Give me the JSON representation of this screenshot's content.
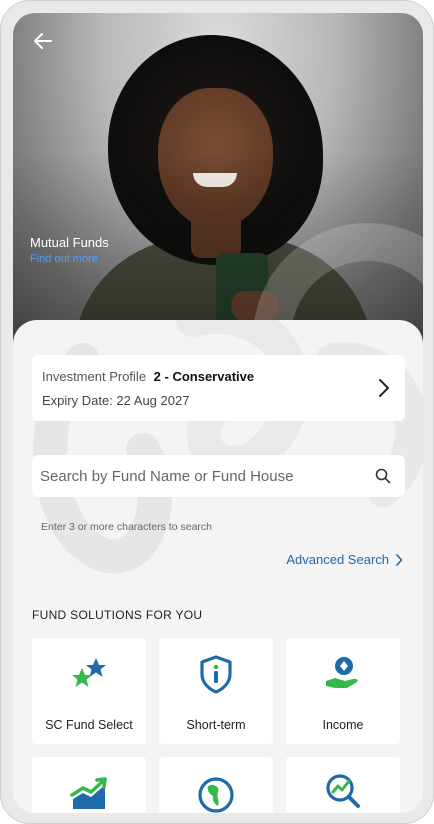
{
  "hero": {
    "title": "Mutual Funds",
    "link": "Find out more"
  },
  "profile": {
    "label": "Investment Profile",
    "value": "2 - Conservative",
    "expiry": "Expiry Date: 22 Aug 2027"
  },
  "search": {
    "placeholder": "Search by Fund Name or Fund House",
    "hint": "Enter 3 or more characters to search",
    "advanced_label": "Advanced Search"
  },
  "solutions": {
    "title": "FUND SOLUTIONS FOR YOU",
    "items": [
      {
        "label": "SC Fund Select",
        "icon": "stars-icon"
      },
      {
        "label": "Short-term",
        "icon": "info-shield-icon"
      },
      {
        "label": "Income",
        "icon": "hand-coin-icon"
      },
      {
        "label": "",
        "icon": "growth-chart-icon"
      },
      {
        "label": "",
        "icon": "globe-icon"
      },
      {
        "label": "",
        "icon": "search-chart-icon"
      }
    ]
  },
  "colors": {
    "accent_blue": "#1f6aa8",
    "accent_green": "#35b84a",
    "link_blue": "#4aa0ff"
  }
}
